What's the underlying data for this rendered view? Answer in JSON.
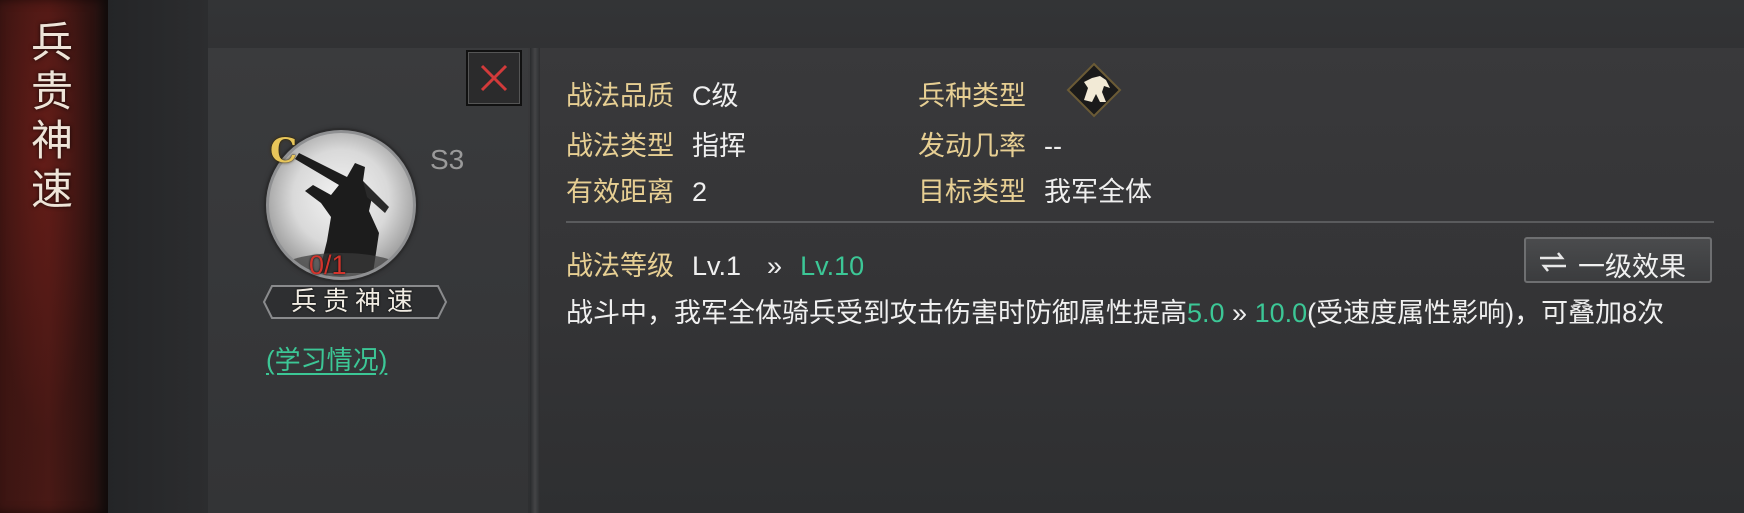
{
  "banner": {
    "title": "兵贵神速"
  },
  "skill": {
    "grade_letter": "C",
    "season": "S3",
    "progress": "0/1",
    "name": "兵贵神速",
    "study_link": "(学习情况)"
  },
  "info": {
    "quality_label": "战法品质",
    "quality_value": "C级",
    "troop_label": "兵种类型",
    "troop_icon": "cavalry-horse-icon",
    "type_label": "战法类型",
    "type_value": "指挥",
    "trigger_label": "发动几率",
    "trigger_value": "--",
    "range_label": "有效距离",
    "range_value": "2",
    "target_label": "目标类型",
    "target_value": "我军全体"
  },
  "level": {
    "label": "战法等级",
    "from": "Lv.1",
    "arrow": "»",
    "to": "Lv.10"
  },
  "effect_button": {
    "label": "一级效果",
    "icon": "swap-arrows-icon"
  },
  "description": {
    "part1": "战斗中，我军全体骑兵受到攻击伤害时防御属性提高",
    "value_from": "5.0",
    "arrow": " » ",
    "value_to": "10.0",
    "part2": "(受速度属性影响)，可叠加8次"
  },
  "colors": {
    "label_gold": "#e7cf93",
    "highlight_green": "#3cc796",
    "progress_red": "#d2342c",
    "close_red": "#d23a3a"
  }
}
